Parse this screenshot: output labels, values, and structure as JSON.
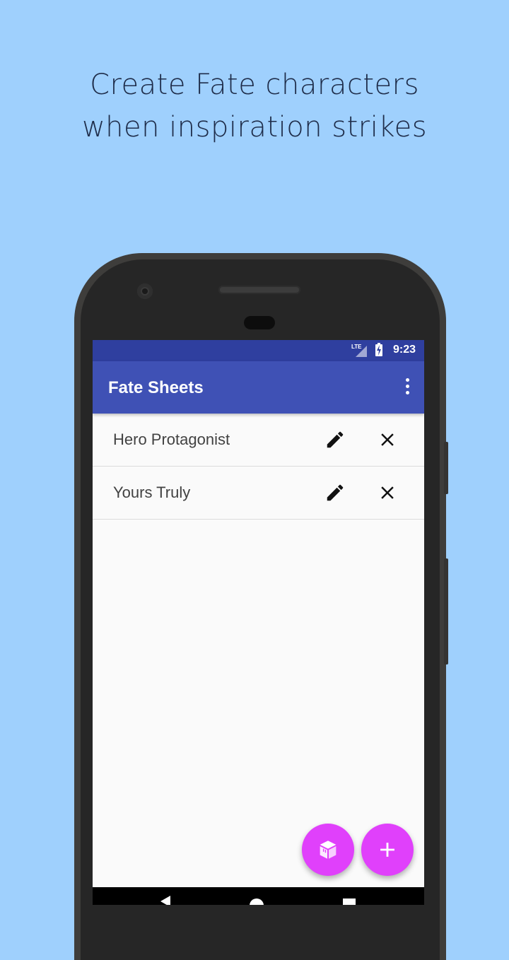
{
  "promo": {
    "headline_line1": "Create Fate characters",
    "headline_line2": "when inspiration strikes"
  },
  "status_bar": {
    "network": "LTE",
    "time": "9:23"
  },
  "app_bar": {
    "title": "Fate Sheets",
    "menu_icon": "more-vert-icon"
  },
  "characters": [
    {
      "name": "Hero Protagonist",
      "edit_icon": "pencil-icon",
      "delete_icon": "close-icon"
    },
    {
      "name": "Yours Truly",
      "edit_icon": "pencil-icon",
      "delete_icon": "close-icon"
    }
  ],
  "fabs": {
    "template_icon": "box-icon",
    "add_icon": "plus-icon"
  },
  "colors": {
    "background": "#9fd0fd",
    "status_bar": "#2f3f9f",
    "app_bar": "#3f51b5",
    "fab": "#e040fb"
  }
}
